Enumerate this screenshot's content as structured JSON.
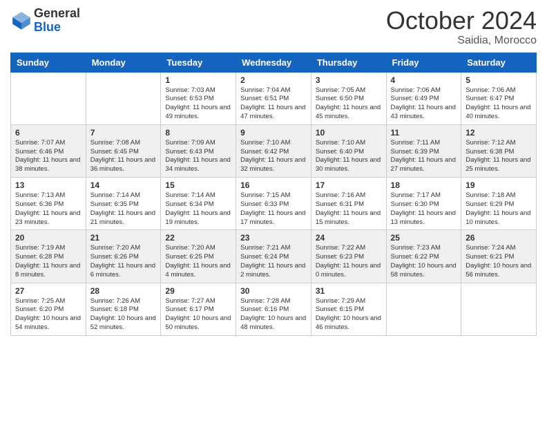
{
  "header": {
    "logo_general": "General",
    "logo_blue": "Blue",
    "month_title": "October 2024",
    "location": "Saidia, Morocco"
  },
  "days_of_week": [
    "Sunday",
    "Monday",
    "Tuesday",
    "Wednesday",
    "Thursday",
    "Friday",
    "Saturday"
  ],
  "weeks": [
    [
      {
        "day": "",
        "info": ""
      },
      {
        "day": "",
        "info": ""
      },
      {
        "day": "1",
        "info": "Sunrise: 7:03 AM\nSunset: 6:53 PM\nDaylight: 11 hours and 49 minutes."
      },
      {
        "day": "2",
        "info": "Sunrise: 7:04 AM\nSunset: 6:51 PM\nDaylight: 11 hours and 47 minutes."
      },
      {
        "day": "3",
        "info": "Sunrise: 7:05 AM\nSunset: 6:50 PM\nDaylight: 11 hours and 45 minutes."
      },
      {
        "day": "4",
        "info": "Sunrise: 7:06 AM\nSunset: 6:49 PM\nDaylight: 11 hours and 43 minutes."
      },
      {
        "day": "5",
        "info": "Sunrise: 7:06 AM\nSunset: 6:47 PM\nDaylight: 11 hours and 40 minutes."
      }
    ],
    [
      {
        "day": "6",
        "info": "Sunrise: 7:07 AM\nSunset: 6:46 PM\nDaylight: 11 hours and 38 minutes."
      },
      {
        "day": "7",
        "info": "Sunrise: 7:08 AM\nSunset: 6:45 PM\nDaylight: 11 hours and 36 minutes."
      },
      {
        "day": "8",
        "info": "Sunrise: 7:09 AM\nSunset: 6:43 PM\nDaylight: 11 hours and 34 minutes."
      },
      {
        "day": "9",
        "info": "Sunrise: 7:10 AM\nSunset: 6:42 PM\nDaylight: 11 hours and 32 minutes."
      },
      {
        "day": "10",
        "info": "Sunrise: 7:10 AM\nSunset: 6:40 PM\nDaylight: 11 hours and 30 minutes."
      },
      {
        "day": "11",
        "info": "Sunrise: 7:11 AM\nSunset: 6:39 PM\nDaylight: 11 hours and 27 minutes."
      },
      {
        "day": "12",
        "info": "Sunrise: 7:12 AM\nSunset: 6:38 PM\nDaylight: 11 hours and 25 minutes."
      }
    ],
    [
      {
        "day": "13",
        "info": "Sunrise: 7:13 AM\nSunset: 6:36 PM\nDaylight: 11 hours and 23 minutes."
      },
      {
        "day": "14",
        "info": "Sunrise: 7:14 AM\nSunset: 6:35 PM\nDaylight: 11 hours and 21 minutes."
      },
      {
        "day": "15",
        "info": "Sunrise: 7:14 AM\nSunset: 6:34 PM\nDaylight: 11 hours and 19 minutes."
      },
      {
        "day": "16",
        "info": "Sunrise: 7:15 AM\nSunset: 6:33 PM\nDaylight: 11 hours and 17 minutes."
      },
      {
        "day": "17",
        "info": "Sunrise: 7:16 AM\nSunset: 6:31 PM\nDaylight: 11 hours and 15 minutes."
      },
      {
        "day": "18",
        "info": "Sunrise: 7:17 AM\nSunset: 6:30 PM\nDaylight: 11 hours and 13 minutes."
      },
      {
        "day": "19",
        "info": "Sunrise: 7:18 AM\nSunset: 6:29 PM\nDaylight: 11 hours and 10 minutes."
      }
    ],
    [
      {
        "day": "20",
        "info": "Sunrise: 7:19 AM\nSunset: 6:28 PM\nDaylight: 11 hours and 8 minutes."
      },
      {
        "day": "21",
        "info": "Sunrise: 7:20 AM\nSunset: 6:26 PM\nDaylight: 11 hours and 6 minutes."
      },
      {
        "day": "22",
        "info": "Sunrise: 7:20 AM\nSunset: 6:25 PM\nDaylight: 11 hours and 4 minutes."
      },
      {
        "day": "23",
        "info": "Sunrise: 7:21 AM\nSunset: 6:24 PM\nDaylight: 11 hours and 2 minutes."
      },
      {
        "day": "24",
        "info": "Sunrise: 7:22 AM\nSunset: 6:23 PM\nDaylight: 11 hours and 0 minutes."
      },
      {
        "day": "25",
        "info": "Sunrise: 7:23 AM\nSunset: 6:22 PM\nDaylight: 10 hours and 58 minutes."
      },
      {
        "day": "26",
        "info": "Sunrise: 7:24 AM\nSunset: 6:21 PM\nDaylight: 10 hours and 56 minutes."
      }
    ],
    [
      {
        "day": "27",
        "info": "Sunrise: 7:25 AM\nSunset: 6:20 PM\nDaylight: 10 hours and 54 minutes."
      },
      {
        "day": "28",
        "info": "Sunrise: 7:26 AM\nSunset: 6:18 PM\nDaylight: 10 hours and 52 minutes."
      },
      {
        "day": "29",
        "info": "Sunrise: 7:27 AM\nSunset: 6:17 PM\nDaylight: 10 hours and 50 minutes."
      },
      {
        "day": "30",
        "info": "Sunrise: 7:28 AM\nSunset: 6:16 PM\nDaylight: 10 hours and 48 minutes."
      },
      {
        "day": "31",
        "info": "Sunrise: 7:29 AM\nSunset: 6:15 PM\nDaylight: 10 hours and 46 minutes."
      },
      {
        "day": "",
        "info": ""
      },
      {
        "day": "",
        "info": ""
      }
    ]
  ]
}
